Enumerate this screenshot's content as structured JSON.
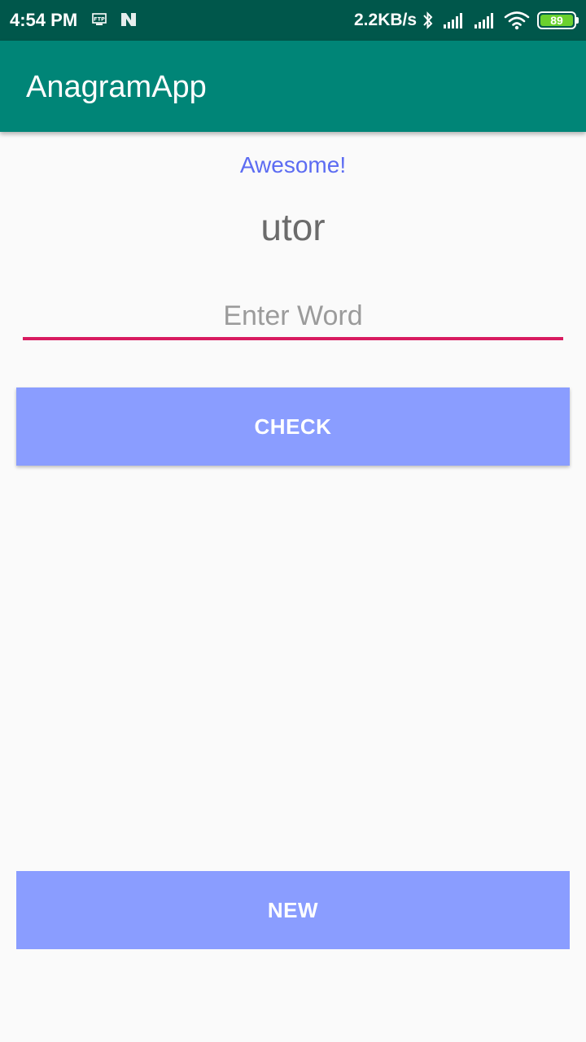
{
  "status_bar": {
    "time": "4:54 PM",
    "network_speed": "2.2KB/s",
    "battery_level": "89",
    "icons": [
      "ftp-icon",
      "n-icon",
      "bluetooth-icon",
      "signal-icon",
      "signal-icon",
      "wifi-icon",
      "battery-icon"
    ]
  },
  "app_bar": {
    "title": "AnagramApp"
  },
  "main": {
    "message": "Awesome!",
    "scrambled_word": "utor",
    "word_input": {
      "value": "",
      "placeholder": "Enter Word"
    },
    "check_button_label": "CHECK",
    "new_button_label": "NEW"
  },
  "colors": {
    "status_bar": "#00574b",
    "app_bar": "#008577",
    "accent": "#d81b60",
    "button": "#8a9dff",
    "message": "#5c6cf2"
  }
}
